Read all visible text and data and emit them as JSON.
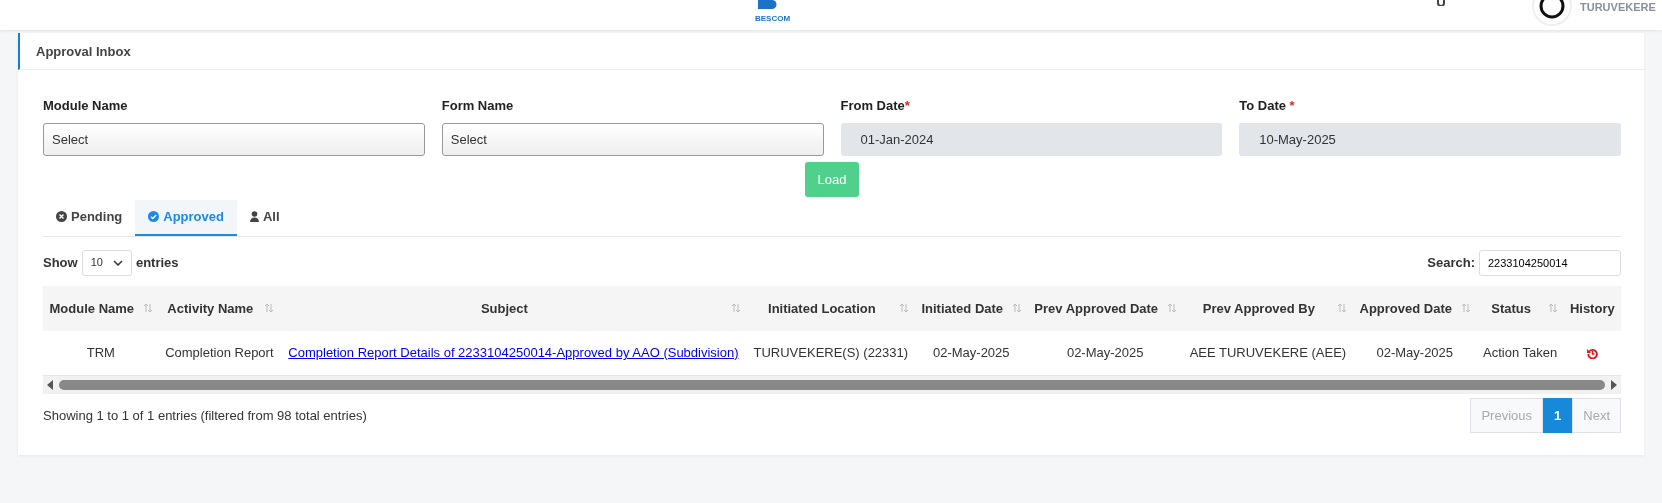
{
  "header": {
    "logo_text": "BESCOM",
    "user_name": "TURUVEKERE"
  },
  "panel": {
    "title": "Approval Inbox"
  },
  "filters": [
    {
      "label": "Module Name",
      "required": false,
      "kind": "select",
      "value": "Select"
    },
    {
      "label": "Form Name",
      "required": false,
      "kind": "select",
      "value": "Select"
    },
    {
      "label": "From Date",
      "required": true,
      "kind": "date",
      "value": "01-Jan-2024"
    },
    {
      "label": "To Date",
      "required": true,
      "kind": "date",
      "value": "10-May-2025"
    }
  ],
  "required_mark": "*",
  "load_button": "Load",
  "tabs": [
    {
      "label": "Pending",
      "selected": false
    },
    {
      "label": "Approved",
      "selected": true
    },
    {
      "label": "All",
      "selected": false
    }
  ],
  "length": {
    "show_label": "Show",
    "value": "10",
    "entries_label": "entries"
  },
  "search": {
    "label": "Search:",
    "value": "2233104250014"
  },
  "table": {
    "columns": [
      {
        "label": "Module Name",
        "sortable": true,
        "kind": "text"
      },
      {
        "label": "Activity Name",
        "sortable": true,
        "kind": "text"
      },
      {
        "label": "Subject",
        "sortable": true,
        "kind": "link"
      },
      {
        "label": "Initiated Location",
        "sortable": true,
        "kind": "text"
      },
      {
        "label": "Initiated Date",
        "sortable": true,
        "kind": "text"
      },
      {
        "label": "Prev Approved Date",
        "sortable": true,
        "kind": "text"
      },
      {
        "label": "Prev Approved By",
        "sortable": true,
        "kind": "text"
      },
      {
        "label": "Approved Date",
        "sortable": true,
        "kind": "text"
      },
      {
        "label": "Status",
        "sortable": true,
        "kind": "text"
      },
      {
        "label": "History",
        "sortable": false,
        "kind": "icon"
      }
    ],
    "rows": [
      {
        "cells": [
          "TRM",
          "Completion Report",
          "Completion Report Details of 2233104250014-Approved by AAO (Subdivision)",
          "TURUVEKERE(S) (22331)",
          "02-May-2025",
          "02-May-2025",
          "AEE TURUVEKERE (AEE)",
          "02-May-2025",
          "Action Taken"
        ]
      }
    ]
  },
  "info": "Showing 1 to 1 of 1 entries (filtered from 98 total entries)",
  "pagination": [
    {
      "label": "Previous",
      "disabled": true,
      "selected": false
    },
    {
      "label": "1",
      "disabled": false,
      "selected": true
    },
    {
      "label": "Next",
      "disabled": true,
      "selected": false
    }
  ]
}
